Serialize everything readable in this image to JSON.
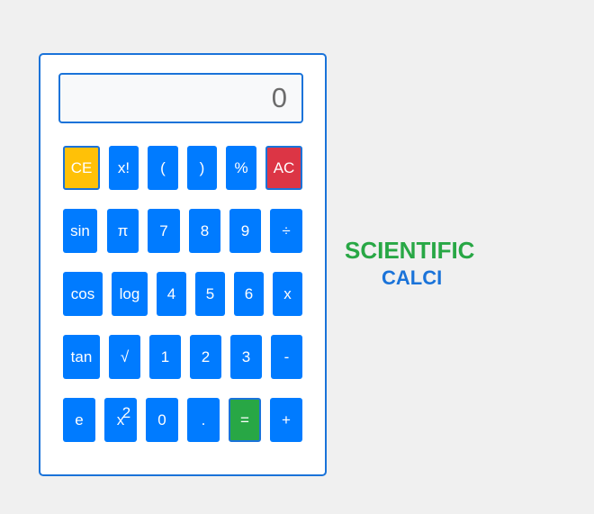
{
  "display": {
    "value": "0"
  },
  "buttons": {
    "row1": [
      "CE",
      "x!",
      "(",
      ")",
      "%",
      "AC"
    ],
    "row2": [
      "sin",
      "π",
      "7",
      "8",
      "9",
      "÷"
    ],
    "row3": [
      "cos",
      "log",
      "4",
      "5",
      "6",
      "x"
    ],
    "row4": [
      "tan",
      "√",
      "1",
      "2",
      "3",
      "-"
    ],
    "row5": [
      "e",
      "x",
      "0",
      ".",
      "=",
      "+"
    ],
    "square_exponent": "2"
  },
  "brand": {
    "title": "SCIENTIFIC",
    "subtitle": "CALCI"
  },
  "colors": {
    "primary": "#007bff",
    "border": "#1a73d9",
    "clear_entry": "#ffc107",
    "all_clear": "#dc3545",
    "equals": "#28a745",
    "title": "#28a745",
    "subtitle": "#1a73d9",
    "background": "#f0f0f0"
  }
}
